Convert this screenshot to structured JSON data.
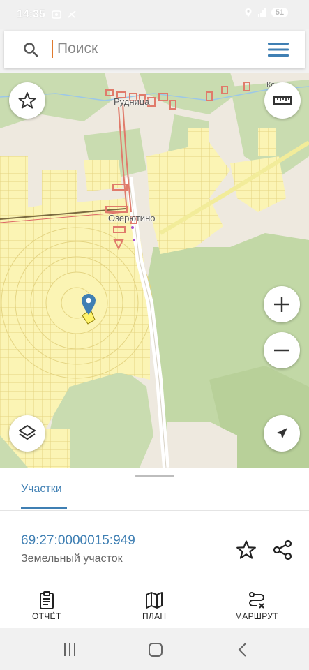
{
  "status_bar": {
    "time": "14:35",
    "battery": "51"
  },
  "search": {
    "placeholder": "Поиск",
    "value": ""
  },
  "map": {
    "labels": {
      "rudnitsa": "Рудница",
      "ozeryutino": "Озерютино",
      "korkhi": "Корчи"
    },
    "colors": {
      "forest": "#c9dcb0",
      "field": "#eee9df",
      "plots": "#fbf4b4",
      "plot_lines": "#e8d98a",
      "building": "#e07b6b",
      "road": "#ffffff",
      "marker": "#3f7fb3",
      "selected_parcel": "#fff36b"
    }
  },
  "sheet": {
    "tab_label": "Участки",
    "parcel_number": "69:27:0000015:949",
    "parcel_type": "Земельный участок"
  },
  "bottom_nav": {
    "report_label": "ОТЧЁТ",
    "plan_label": "ПЛАН",
    "route_label": "МАРШРУТ"
  },
  "icons": {
    "search": "search-icon",
    "menu": "menu-icon",
    "favorite": "star-icon",
    "ruler": "ruler-icon",
    "layers": "layers-icon",
    "zoom_in": "plus-icon",
    "zoom_out": "minus-icon",
    "locate": "navigation-arrow-icon",
    "share": "share-icon",
    "report": "clipboard-icon",
    "plan": "map-icon",
    "route": "route-icon"
  }
}
